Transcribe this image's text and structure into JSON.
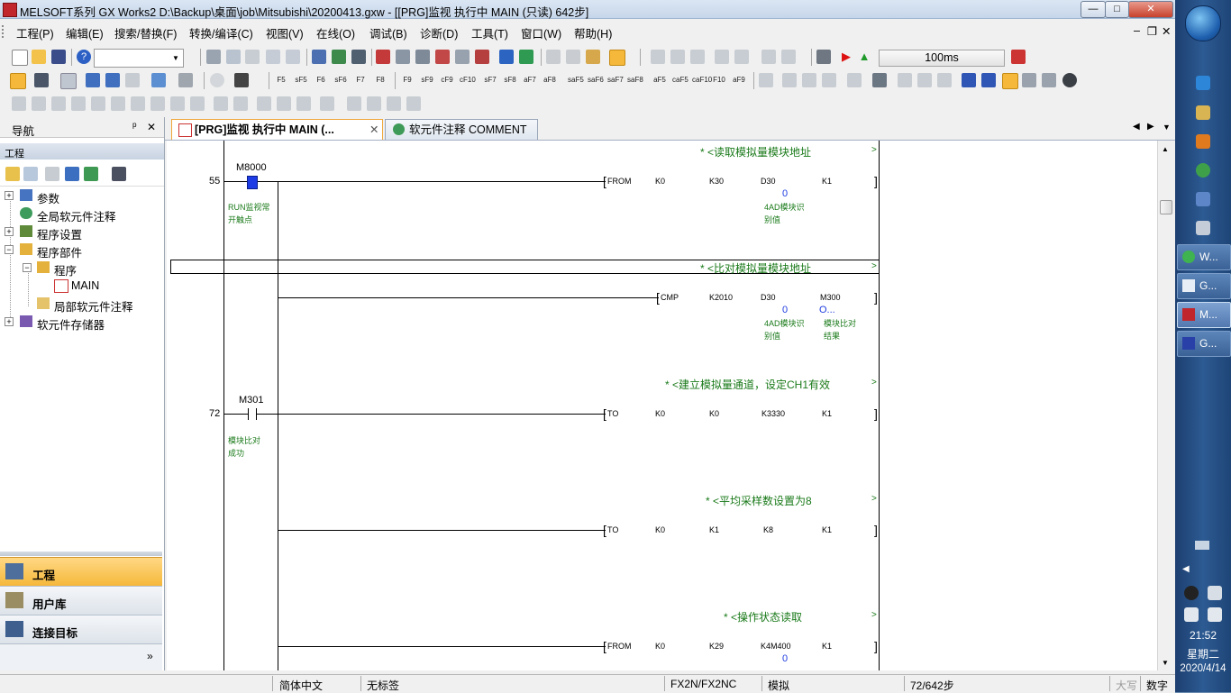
{
  "window": {
    "title": "MELSOFT系列 GX Works2 D:\\Backup\\桌面\\job\\Mitsubishi\\20200413.gxw - [[PRG]监视 执行中 MAIN (只读) 642步]",
    "min": "—",
    "max": "□",
    "close": "✕",
    "mdi_min": "–",
    "mdi_restore": "❐",
    "mdi_close": "✕"
  },
  "menu": [
    "工程(P)",
    "编辑(E)",
    "搜索/替换(F)",
    "转换/编译(C)",
    "视图(V)",
    "在线(O)",
    "调试(B)",
    "诊断(D)",
    "工具(T)",
    "窗口(W)",
    "帮助(H)"
  ],
  "toolbar": {
    "monitor_interval": "100ms",
    "fkeys": [
      "F5",
      "sF5",
      "F6",
      "sF6",
      "F7",
      "F8",
      "F9",
      "sF9",
      "cF9",
      "cF10",
      "sF7",
      "sF8",
      "aF7",
      "aF8",
      "saF5",
      "saF6",
      "saF7",
      "saF8",
      "aF5",
      "caF5",
      "caF10",
      "F10",
      "aF9"
    ]
  },
  "navigator": {
    "title": "导航",
    "pin": "ᵖ",
    "close": "✕",
    "section": "工程",
    "tree": [
      {
        "label": "参数",
        "level": 0,
        "exp": "+"
      },
      {
        "label": "全局软元件注释",
        "level": 0,
        "exp": ""
      },
      {
        "label": "程序设置",
        "level": 0,
        "exp": "+"
      },
      {
        "label": "程序部件",
        "level": 0,
        "exp": "−"
      },
      {
        "label": "程序",
        "level": 1,
        "exp": "−"
      },
      {
        "label": "MAIN",
        "level": 2,
        "exp": ""
      },
      {
        "label": "局部软元件注释",
        "level": 1,
        "exp": ""
      },
      {
        "label": "软元件存储器",
        "level": 0,
        "exp": "+"
      }
    ],
    "bottom_buttons": [
      "工程",
      "用户库",
      "连接目标"
    ],
    "more": "»"
  },
  "tabs": [
    {
      "label": "[PRG]监视 执行中 MAIN (...",
      "active": true
    },
    {
      "label": "软元件注释 COMMENT",
      "active": false
    }
  ],
  "tab_close": "✕",
  "ladder": {
    "rungs": [
      {
        "comment": "* <读取模拟量模块地址",
        "step": "55",
        "contact": "M8000",
        "contact_note": [
          "RUN监视常",
          "开触点"
        ],
        "instr": "FROM",
        "ops": [
          "K0",
          "K30",
          "D30",
          "K1"
        ],
        "value": "0",
        "dev_note": [
          "4AD模块识",
          "别值"
        ]
      },
      {
        "comment": "* <比对模拟量模块地址",
        "instr": "CMP",
        "ops": [
          "K2010",
          "D30",
          "M300"
        ],
        "value": "0",
        "value2": "O...",
        "dev_note": [
          "4AD模块识",
          "别值"
        ],
        "dev_note2": [
          "模块比对",
          "结果"
        ]
      },
      {
        "comment": "* <建立模拟量通道，设定CH1有效",
        "step": "72",
        "contact": "M301",
        "contact_note": [
          "模块比对",
          "成功"
        ],
        "instr": "TO",
        "ops": [
          "K0",
          "K0",
          "K3330",
          "K1"
        ]
      },
      {
        "comment": "* <平均采样数设置为8",
        "instr": "TO",
        "ops": [
          "K0",
          "K1",
          "K8",
          "K1"
        ]
      },
      {
        "comment": "* <操作状态读取",
        "instr": "FROM",
        "ops": [
          "K0",
          "K29",
          "K4M400",
          "K1"
        ],
        "value": "0"
      }
    ],
    "comment_end": ">"
  },
  "status": {
    "language": "简体中文",
    "label": "无标签",
    "plc": "FX2N/FX2NC",
    "mode": "模拟",
    "steps": "72/642步",
    "caps": "大写",
    "num": "数字"
  },
  "taskbar": {
    "items": [
      "W...",
      "G...",
      "M...",
      "G..."
    ],
    "time": "21:52",
    "weekday": "星期二",
    "date": "2020/4/14"
  },
  "colors": {
    "accent": "#f5b83a",
    "comment": "#1a7a1a",
    "value": "#1e3ce0"
  }
}
